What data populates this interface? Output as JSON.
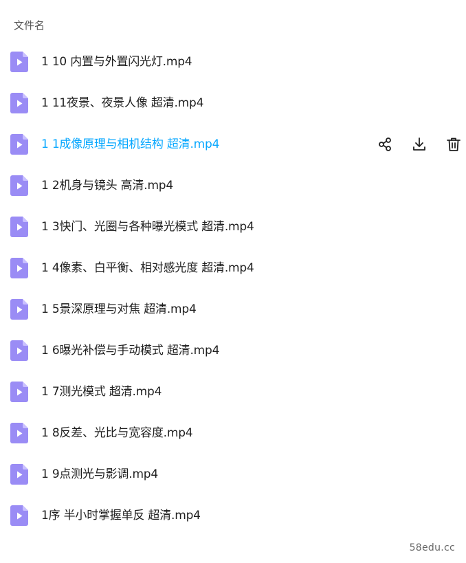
{
  "header": {
    "label": "文件名"
  },
  "icons": {
    "file": "video-file-icon",
    "share": "share-icon",
    "download": "download-icon",
    "delete": "trash-icon"
  },
  "colors": {
    "accent": "#06a7ff",
    "file_icon_body": "#9a8cf5",
    "file_icon_fold": "#c9c0ff"
  },
  "files": [
    {
      "name": "1 10 内置与外置闪光灯.mp4"
    },
    {
      "name": "1 11夜景、夜景人像 超清.mp4"
    },
    {
      "name": "1 1成像原理与相机结构 超清.mp4",
      "active": true
    },
    {
      "name": "1 2机身与镜头 高清.mp4"
    },
    {
      "name": "1 3快门、光圈与各种曝光模式 超清.mp4"
    },
    {
      "name": "1 4像素、白平衡、相对感光度 超清.mp4"
    },
    {
      "name": "1 5景深原理与对焦 超清.mp4"
    },
    {
      "name": "1 6曝光补偿与手动模式 超清.mp4"
    },
    {
      "name": "1 7测光模式 超清.mp4"
    },
    {
      "name": "1 8反差、光比与宽容度.mp4"
    },
    {
      "name": "1 9点测光与影调.mp4"
    },
    {
      "name": "1序 半小时掌握单反 超清.mp4"
    }
  ],
  "watermark": "58edu.cc"
}
